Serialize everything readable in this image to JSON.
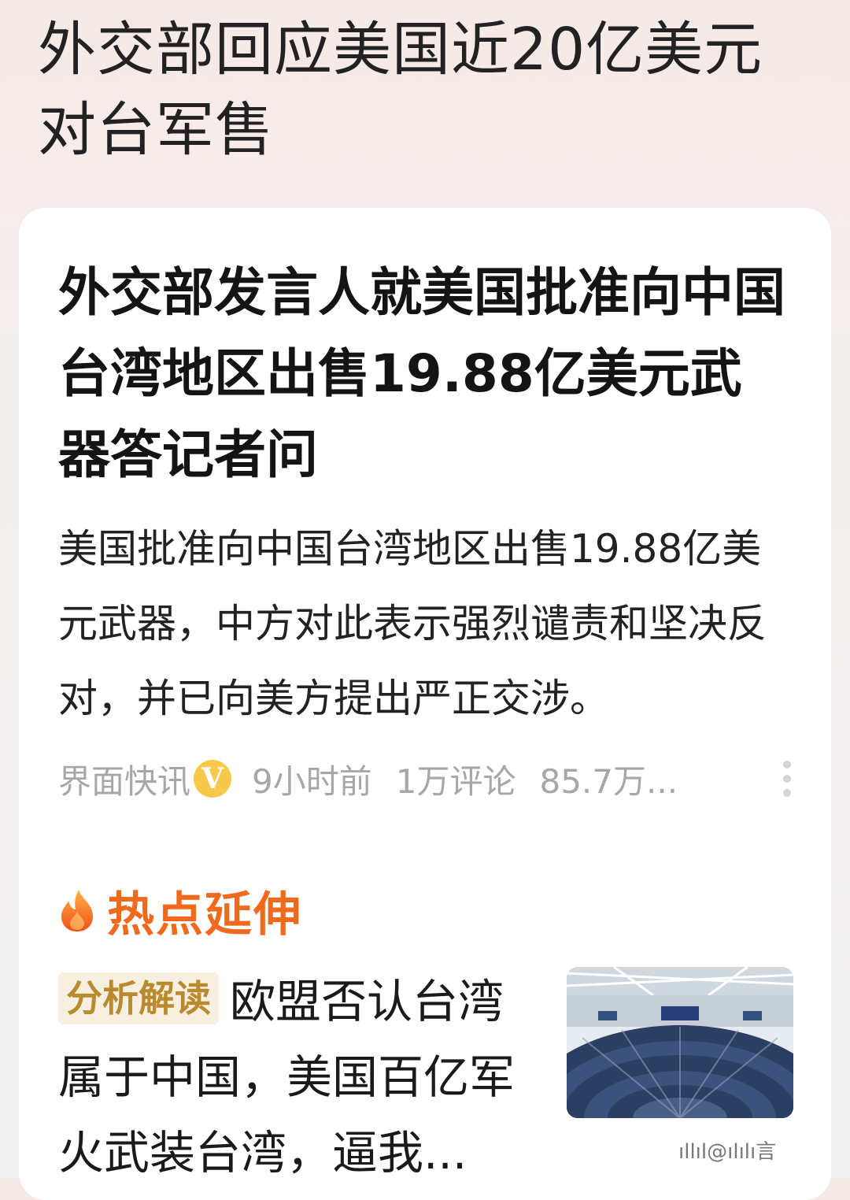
{
  "page_header": {
    "title": "外交部回应美国近20亿美元对台军售"
  },
  "news_card": {
    "title": "外交部发言人就美国批准向中国台湾地区出售19.88亿美元武器答记者问",
    "summary": "美国批准向中国台湾地区出售19.88亿美元武器，中方对此表示强烈谴责和坚决反对，并已向美方提出严正交涉。",
    "meta": {
      "source": "界面快讯",
      "verified_badge": "V",
      "time": "9小时前",
      "comments": "1万评论",
      "views": "85.7万..."
    },
    "more_icon": "more-vertical-icon"
  },
  "hot_extension": {
    "icon": "flame-icon",
    "title": "热点延伸",
    "item": {
      "tag": "分析解读",
      "text": "欧盟否认台湾属于中国，美国百亿军火武装台湾，逼我...",
      "thumbnail": "parliament-chamber-photo"
    }
  },
  "watermark": "ıllıl@ılılı言",
  "colors": {
    "accent_orange": "#ef6a1c",
    "tag_text": "#b98a2e",
    "tag_bg": "#f7f0e0",
    "meta_gray": "#a7a7a7",
    "verified_yellow": "#f7c84a"
  }
}
